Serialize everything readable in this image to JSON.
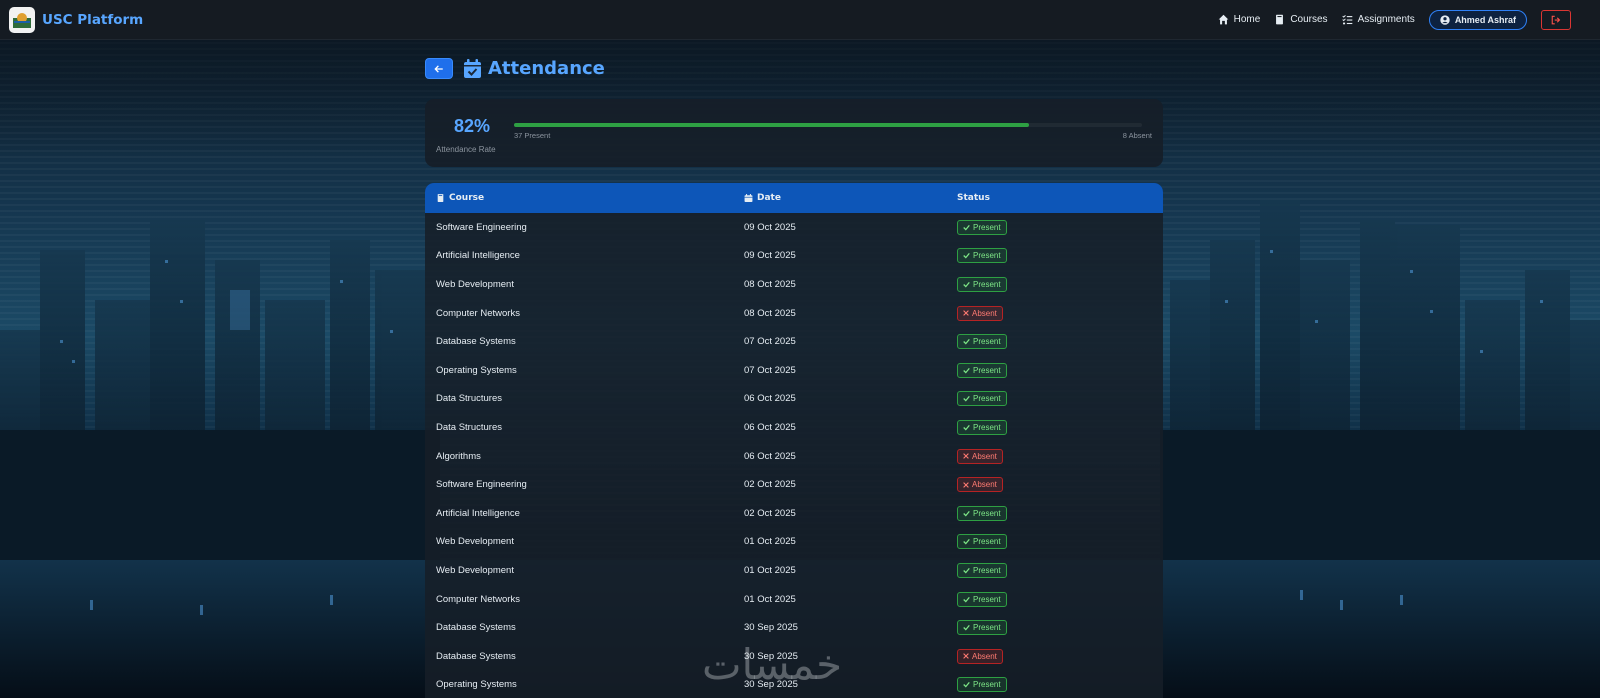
{
  "app": {
    "brand": "USC Platform"
  },
  "nav": {
    "items": [
      {
        "label": "Home",
        "icon": "home-icon"
      },
      {
        "label": "Courses",
        "icon": "book-icon"
      },
      {
        "label": "Assignments",
        "icon": "list-check-icon"
      }
    ],
    "user": "Ahmed Ashraf"
  },
  "header": {
    "title": "Attendance",
    "icon": "calendar-check-icon"
  },
  "stats": {
    "rate": "82%",
    "rate_label": "Attendance Rate",
    "present": "37 Present",
    "absent": "8 Absent",
    "progress_fraction": 0.82
  },
  "table": {
    "headers": {
      "course": "Course",
      "date": "Date",
      "status": "Status"
    },
    "rows": [
      {
        "course": "Software Engineering",
        "date": "09 Oct 2025",
        "status": "Present"
      },
      {
        "course": "Artificial Intelligence",
        "date": "09 Oct 2025",
        "status": "Present"
      },
      {
        "course": "Web Development",
        "date": "08 Oct 2025",
        "status": "Present"
      },
      {
        "course": "Computer Networks",
        "date": "08 Oct 2025",
        "status": "Absent"
      },
      {
        "course": "Database Systems",
        "date": "07 Oct 2025",
        "status": "Present"
      },
      {
        "course": "Operating Systems",
        "date": "07 Oct 2025",
        "status": "Present"
      },
      {
        "course": "Data Structures",
        "date": "06 Oct 2025",
        "status": "Present"
      },
      {
        "course": "Data Structures",
        "date": "06 Oct 2025",
        "status": "Present"
      },
      {
        "course": "Algorithms",
        "date": "06 Oct 2025",
        "status": "Absent"
      },
      {
        "course": "Software Engineering",
        "date": "02 Oct 2025",
        "status": "Absent"
      },
      {
        "course": "Artificial Intelligence",
        "date": "02 Oct 2025",
        "status": "Present"
      },
      {
        "course": "Web Development",
        "date": "01 Oct 2025",
        "status": "Present"
      },
      {
        "course": "Web Development",
        "date": "01 Oct 2025",
        "status": "Present"
      },
      {
        "course": "Computer Networks",
        "date": "01 Oct 2025",
        "status": "Present"
      },
      {
        "course": "Database Systems",
        "date": "30 Sep 2025",
        "status": "Present"
      },
      {
        "course": "Database Systems",
        "date": "30 Sep 2025",
        "status": "Absent"
      },
      {
        "course": "Operating Systems",
        "date": "30 Sep 2025",
        "status": "Present"
      }
    ]
  },
  "watermark": "خمسات",
  "colors": {
    "accent": "#58a6ff",
    "table_header": "#0d56b8",
    "present": "#2ea043",
    "absent": "#da3633",
    "nav_bg": "#151b22"
  }
}
